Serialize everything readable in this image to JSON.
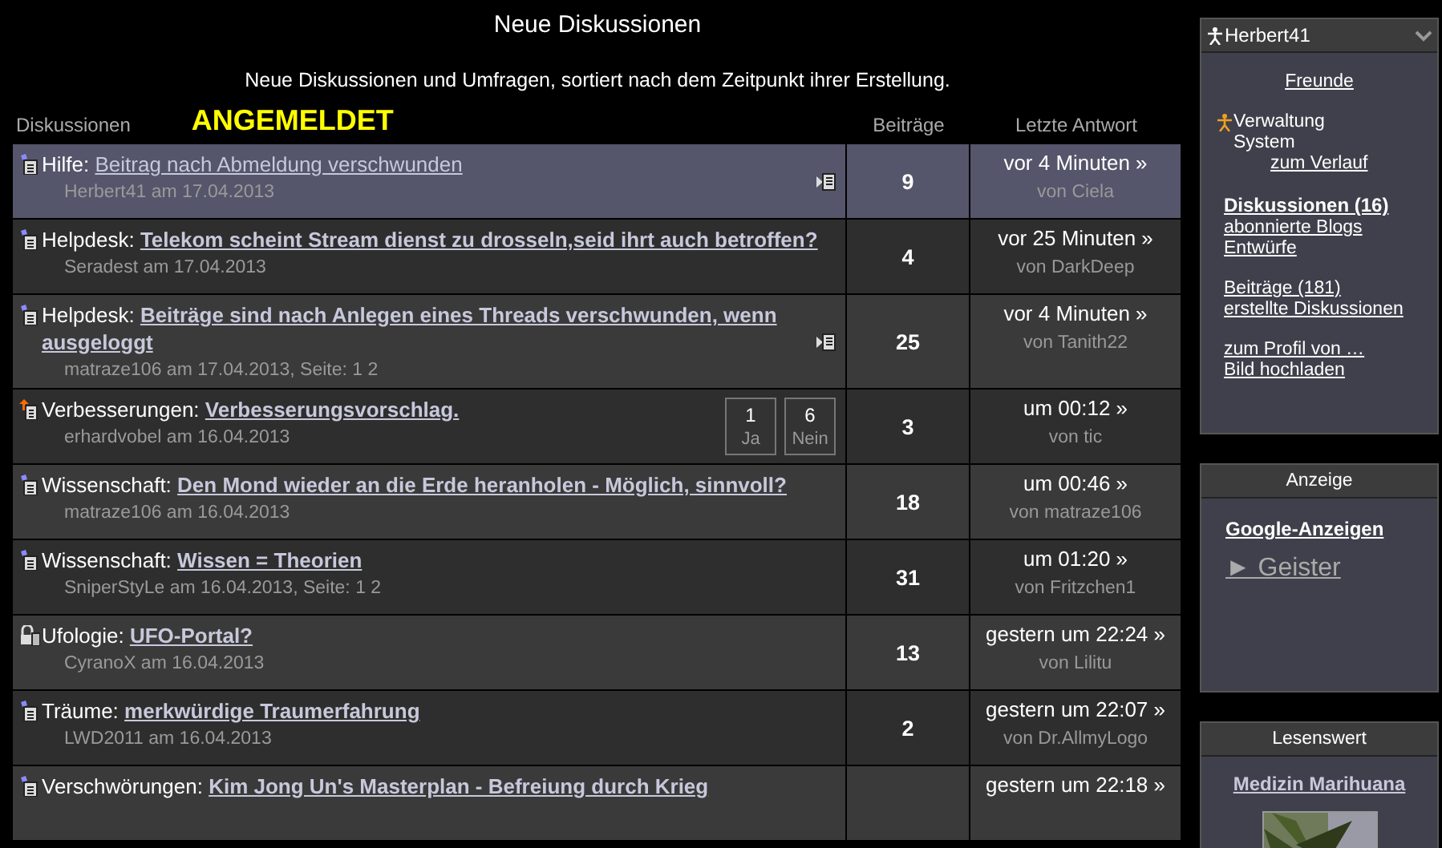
{
  "page": {
    "title": "Neue Diskussionen",
    "subtitle": "Neue Diskussionen und Umfragen, sortiert nach dem Zeitpunkt ihrer Erstellung.",
    "banner": "ANGEMELDET"
  },
  "table": {
    "columns": [
      "Diskussionen",
      "Beiträge",
      "Letzte Antwort"
    ],
    "rows": [
      {
        "kind": "normal",
        "highlighted": true,
        "unread": false,
        "category": "Hilfe:",
        "title": "Beitrag nach Abmeldung verschwunden",
        "meta": "Herbert41 am 17.04.2013",
        "last_page_icon": true,
        "count": "9",
        "last": "vor 4 Minuten »",
        "by": "von Ciela"
      },
      {
        "kind": "normal",
        "highlighted": false,
        "unread": true,
        "category": "Helpdesk:",
        "title": "Telekom scheint Stream dienst zu drosseln,seid ihrt auch betroffen?",
        "meta": "Seradest am 17.04.2013",
        "last_page_icon": false,
        "count": "4",
        "last": "vor 25 Minuten »",
        "by": "von DarkDeep"
      },
      {
        "kind": "normal",
        "highlighted": false,
        "unread": true,
        "category": "Helpdesk:",
        "title": "Beiträge sind nach Anlegen eines Threads verschwunden, wenn ausgeloggt",
        "meta": "matraze106 am 17.04.2013, Seite: 1 2",
        "last_page_icon": true,
        "count": "25",
        "last": "vor 4 Minuten »",
        "by": "von Tanith22"
      },
      {
        "kind": "hot",
        "highlighted": false,
        "unread": true,
        "category": "Verbesserungen:",
        "title": "Verbesserungsvorschlag.",
        "meta": "erhardvobel am 16.04.2013",
        "last_page_icon": false,
        "poll": [
          {
            "count": "1",
            "label": "Ja"
          },
          {
            "count": "6",
            "label": "Nein"
          }
        ],
        "count": "3",
        "last": "um 00:12 »",
        "by": "von tic"
      },
      {
        "kind": "normal",
        "highlighted": false,
        "unread": true,
        "category": "Wissenschaft:",
        "title": "Den Mond wieder an die Erde heranholen - Möglich, sinnvoll?",
        "meta": "matraze106 am 16.04.2013",
        "last_page_icon": false,
        "count": "18",
        "last": "um 00:46 »",
        "by": "von matraze106"
      },
      {
        "kind": "normal",
        "highlighted": false,
        "unread": true,
        "category": "Wissenschaft:",
        "title": "Wissen = Theorien",
        "meta": "SniperStyLe am 16.04.2013, Seite: 1 2",
        "last_page_icon": false,
        "count": "31",
        "last": "um 01:20 »",
        "by": "von Fritzchen1"
      },
      {
        "kind": "locked",
        "highlighted": false,
        "unread": true,
        "category": "Ufologie:",
        "title": "UFO-Portal?",
        "meta": "CyranoX am 16.04.2013",
        "last_page_icon": false,
        "count": "13",
        "last": "gestern um 22:24 »",
        "by": "von Lilitu"
      },
      {
        "kind": "normal",
        "highlighted": false,
        "unread": true,
        "category": "Träume:",
        "title": "merkwürdige Traumerfahrung",
        "meta": "LWD2011 am 16.04.2013",
        "last_page_icon": false,
        "count": "2",
        "last": "gestern um 22:07 »",
        "by": "von Dr.AllmyLogo"
      },
      {
        "kind": "normal",
        "highlighted": false,
        "unread": true,
        "category": "Verschwörungen:",
        "title": "Kim Jong Un's Masterplan - Befreiung durch Krieg",
        "last_page_icon": false,
        "last": "gestern um 22:18 »"
      }
    ]
  },
  "sidebar": {
    "user_box": {
      "name": "Herbert41",
      "groups": [
        [
          {
            "kind": "centered",
            "label": "Freunde"
          }
        ],
        [
          {
            "kind": "admin",
            "label": "Verwaltung"
          },
          {
            "kind": "sub",
            "label": "System"
          },
          {
            "kind": "subsub",
            "label": "zum Verlauf"
          }
        ],
        [
          {
            "kind": "strong",
            "label": "Diskussionen (16)"
          },
          {
            "kind": "link",
            "label": "abonnierte Blogs"
          },
          {
            "kind": "link",
            "label": "Entwürfe"
          }
        ],
        [
          {
            "kind": "link",
            "label": "Beiträge (181)"
          },
          {
            "kind": "link",
            "label": "erstellte Diskussionen"
          }
        ],
        [
          {
            "kind": "link",
            "label": "zum Profil von …"
          },
          {
            "kind": "link",
            "label": "Bild hochladen"
          }
        ]
      ]
    },
    "ad_box": {
      "title": "Anzeige",
      "heading": "Google-Anzeigen",
      "link": "► Geister"
    },
    "read_box": {
      "title": "Lesenswert",
      "article": "Medizin Marihuana"
    }
  }
}
